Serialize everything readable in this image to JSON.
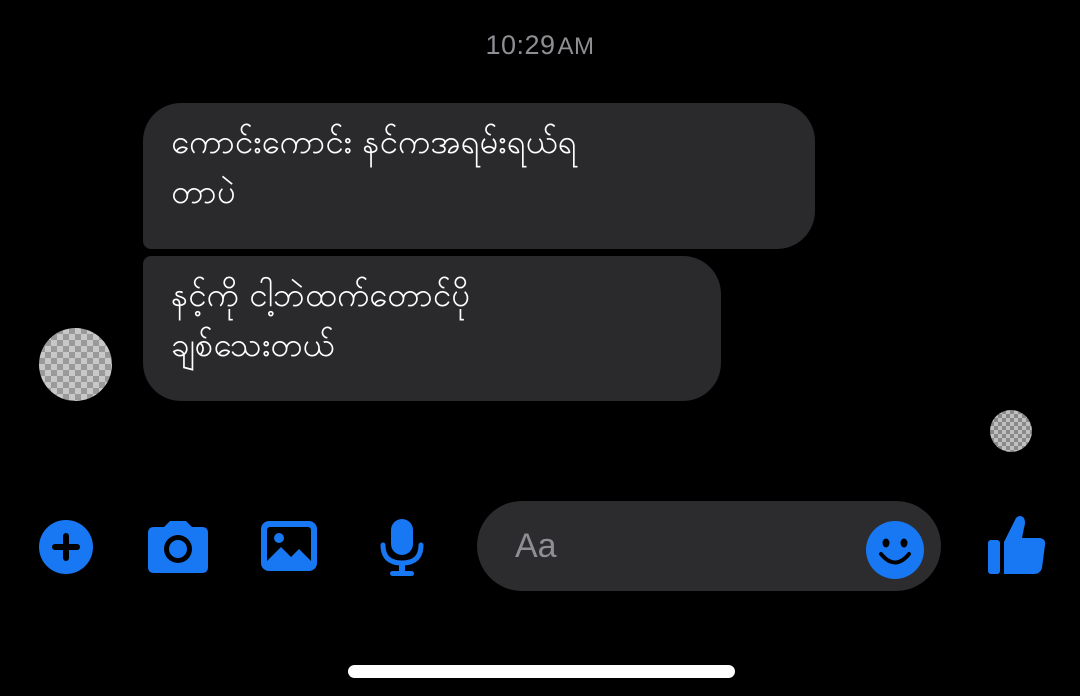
{
  "status": {
    "time": "10:29",
    "ampm": "AM"
  },
  "messages": [
    {
      "text": "ကောင်းကောင်း နင်ကအရမ်းရယ်ရ\nတာပဲ"
    },
    {
      "text": "နင့်ကို ငါ့ဘဲထက်တောင်ပို\nချစ်သေးတယ်"
    }
  ],
  "composer": {
    "placeholder": "Aa"
  },
  "icons": {
    "add": "plus-circle-icon",
    "camera": "camera-icon",
    "gallery": "image-icon",
    "mic": "microphone-icon",
    "emoji": "emoji-icon",
    "like": "thumbs-up-icon"
  },
  "colors": {
    "accent": "#1877f2",
    "bubble": "#2a2a2c",
    "background": "#000000"
  }
}
